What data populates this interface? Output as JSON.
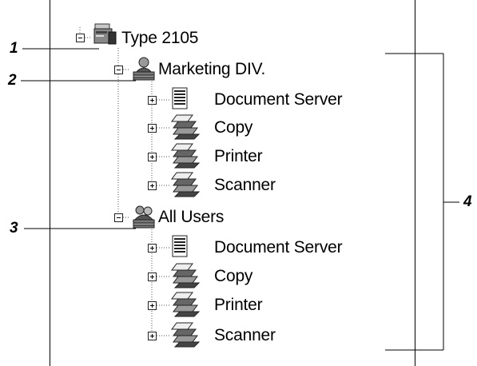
{
  "tree": {
    "root": {
      "label": "Type 2105"
    },
    "groups": [
      {
        "label": "Marketing DIV.",
        "children": [
          {
            "label": "Document Server"
          },
          {
            "label": "Copy"
          },
          {
            "label": "Printer"
          },
          {
            "label": "Scanner"
          }
        ]
      },
      {
        "label": "All Users",
        "children": [
          {
            "label": "Document Server"
          },
          {
            "label": "Copy"
          },
          {
            "label": "Printer"
          },
          {
            "label": "Scanner"
          }
        ]
      }
    ]
  },
  "callouts": [
    "1",
    "2",
    "3",
    "4"
  ]
}
